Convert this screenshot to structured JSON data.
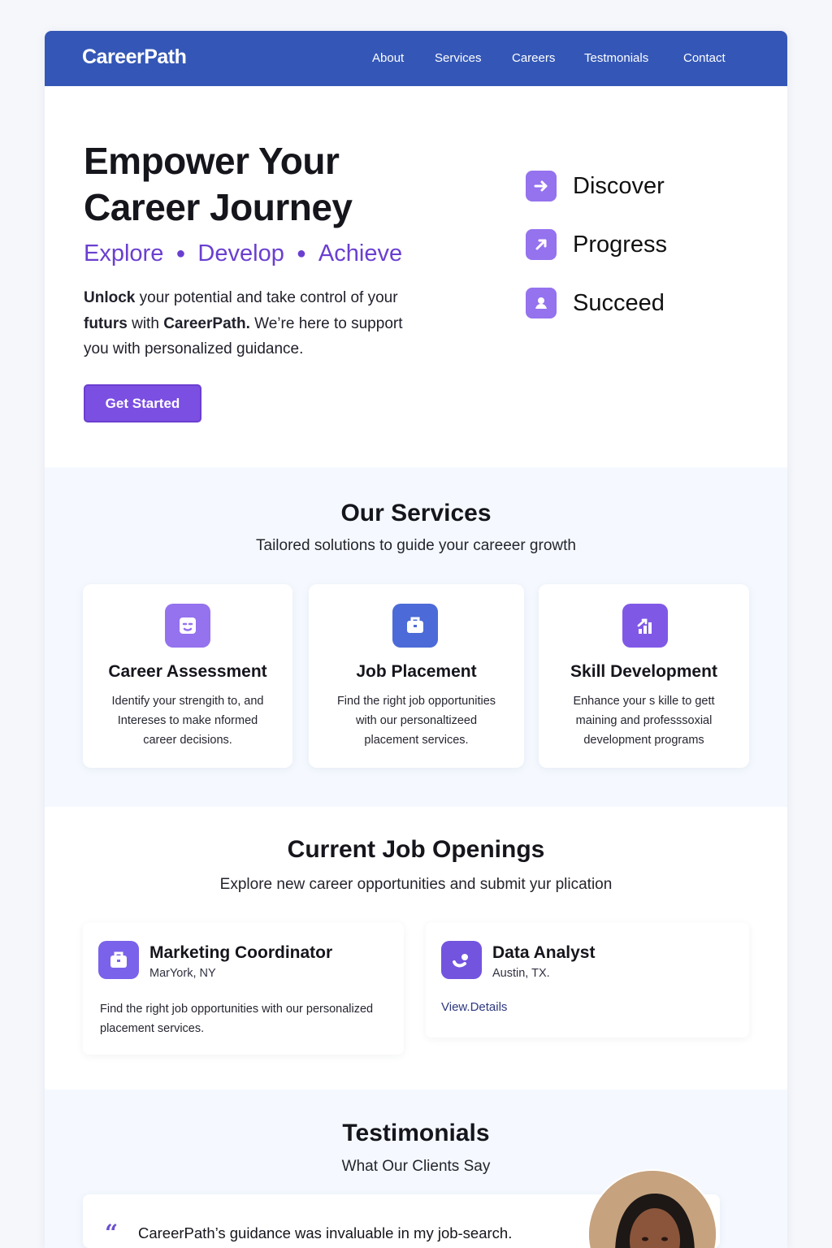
{
  "header": {
    "brand": "CareerPath",
    "nav": [
      "About",
      "Services",
      "Careers",
      "Testmonials",
      "Contact"
    ]
  },
  "hero": {
    "title_line1": "Empower Your",
    "title_line2": "Career Journey",
    "tagline": [
      "Explore",
      "Develop",
      "Achieve"
    ],
    "body": [
      {
        "text": "Unlock",
        "strong": true
      },
      {
        "text": " your potential and take control of your ",
        "strong": false
      },
      {
        "text": "futurs",
        "strong": true
      },
      {
        "text": " with ",
        "strong": false
      },
      {
        "text": "CareerPath.",
        "strong": true
      },
      {
        "text": " We’re here to support you with personalized guidance.",
        "strong": false
      }
    ],
    "cta_label": "Get Started",
    "steps": [
      {
        "label": "Discover",
        "icon": "arrow-right-icon"
      },
      {
        "label": "Progress",
        "icon": "arrow-up-right-icon"
      },
      {
        "label": "Succeed",
        "icon": "user-icon"
      }
    ]
  },
  "services": {
    "title": "Our Services",
    "subtitle": "Tailored solutions to guide your careeer growth",
    "items": [
      {
        "title": "Career Assessment",
        "description": "Identify your strengith to, and Intereses to make nformed career decisions.",
        "icon": "assessment-face-icon",
        "color": "#9572ee"
      },
      {
        "title": "Job Placement",
        "description": "Find the right job opportunities with our personaltizeed placement services.",
        "icon": "briefcase-icon",
        "color": "#4c6ad8"
      },
      {
        "title": "Skill Development",
        "description": "Enhance your s kille to gett maining and professsoxial development programs",
        "icon": "growth-chart-icon",
        "color": "#8058e6"
      }
    ]
  },
  "jobs": {
    "title": "Current Job Openings",
    "subtitle": "Explore new career opportunities and submit yur plication",
    "items": [
      {
        "title": "Marketing Coordinator",
        "location": "MarYork, NY",
        "description": "Find the right job opportunities with our personalized placement services.",
        "icon": "briefcase-icon",
        "color": "#7b62ea"
      },
      {
        "title": "Data Analyst",
        "location": "Austin, TX.",
        "link_label": "View.Details",
        "icon": "analytics-person-icon",
        "color": "#7354df"
      }
    ]
  },
  "testimonials": {
    "title": "Testimonials",
    "subtitle": "What Our Clients Say",
    "quote": "CareerPath’s guidance was invaluable in my job-search."
  }
}
